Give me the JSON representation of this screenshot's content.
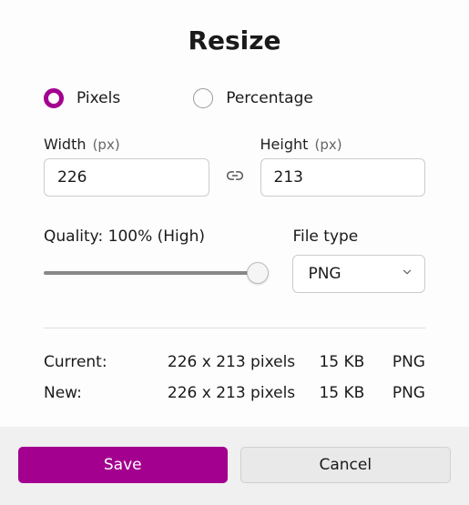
{
  "title": "Resize",
  "mode": {
    "pixels_label": "Pixels",
    "percentage_label": "Percentage"
  },
  "width": {
    "label": "Width",
    "unit": "(px)",
    "value": "226"
  },
  "height": {
    "label": "Height",
    "unit": "(px)",
    "value": "213"
  },
  "quality": {
    "label": "Quality: 100% (High)"
  },
  "filetype": {
    "label": "File type",
    "value": "PNG"
  },
  "current": {
    "label": "Current:",
    "dims": "226 x 213 pixels",
    "size": "15 KB",
    "fmt": "PNG"
  },
  "new": {
    "label": "New:",
    "dims": "226 x 213 pixels",
    "size": "15 KB",
    "fmt": "PNG"
  },
  "buttons": {
    "save": "Save",
    "cancel": "Cancel"
  }
}
